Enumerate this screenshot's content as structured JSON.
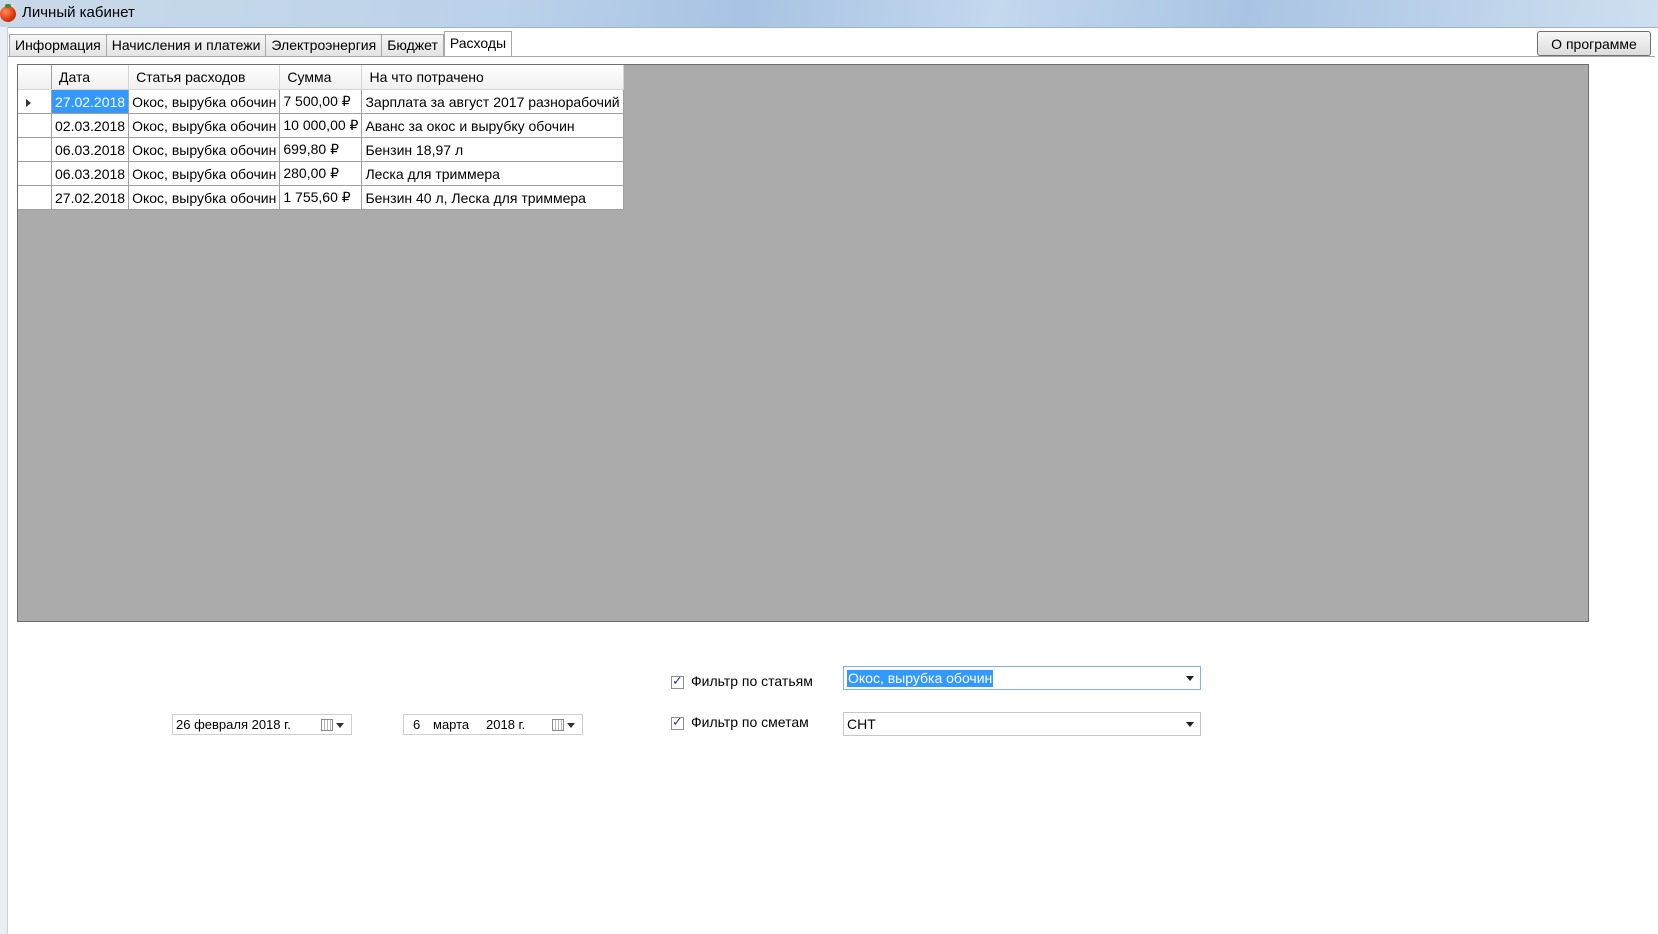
{
  "window": {
    "title": "Личный кабинет"
  },
  "tabs": [
    {
      "label": "Информация"
    },
    {
      "label": "Начисления и платежи"
    },
    {
      "label": "Электроэнергия"
    },
    {
      "label": "Бюджет"
    },
    {
      "label": "Расходы"
    }
  ],
  "active_tab": "Расходы",
  "about_button": {
    "label": "О программе"
  },
  "table": {
    "columns": [
      "Дата",
      "Статья расходов",
      "Сумма",
      "На что потрачено"
    ],
    "rows": [
      {
        "date": "27.02.2018",
        "article": "Окос, вырубка обочин",
        "sum": "7 500,00 ₽",
        "purpose": "Зарплата за август 2017 разнорабочий"
      },
      {
        "date": "02.03.2018",
        "article": "Окос, вырубка обочин",
        "sum": "10 000,00 ₽",
        "purpose": "Аванс за окос и вырубку обочин"
      },
      {
        "date": "06.03.2018",
        "article": "Окос, вырубка обочин",
        "sum": "699,80 ₽",
        "purpose": "Бензин 18,97 л"
      },
      {
        "date": "06.03.2018",
        "article": "Окос, вырубка обочин",
        "sum": "280,00 ₽",
        "purpose": "Леска для триммера"
      },
      {
        "date": "27.02.2018",
        "article": "Окос, вырубка обочин",
        "sum": "1 755,60 ₽",
        "purpose": "Бензин 40 л, Леска для триммера"
      }
    ]
  },
  "filters": {
    "date_from": "26 февраля 2018 г.",
    "date_to_day": "6",
    "date_to_month": "марта",
    "date_to_year": "2018 г.",
    "by_article": {
      "label": "Фильтр по статьям",
      "checked": true,
      "value": "Окос, вырубка обочин"
    },
    "by_estimate": {
      "label": "Фильтр по сметам",
      "checked": true,
      "value": "СНТ"
    }
  }
}
